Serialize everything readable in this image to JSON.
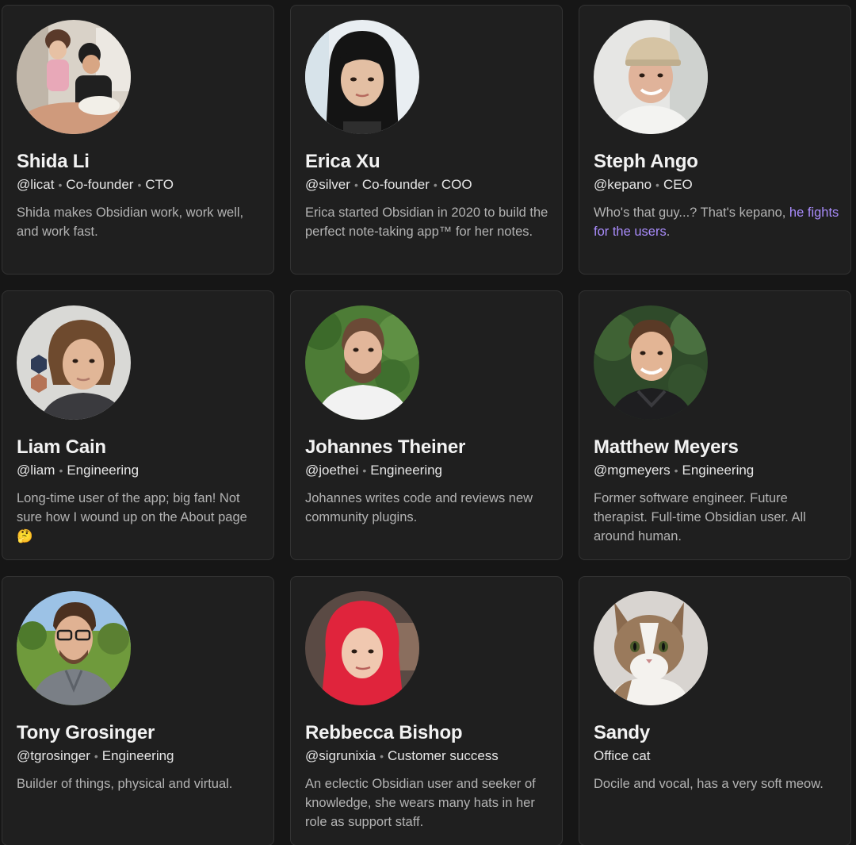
{
  "team": [
    {
      "name": "Shida Li",
      "handle": "@licat",
      "roles": [
        "Co-founder",
        "CTO"
      ],
      "bio": "Shida makes Obsidian work, work well, and work fast.",
      "avatar": "avatar-family-photo"
    },
    {
      "name": "Erica Xu",
      "handle": "@silver",
      "roles": [
        "Co-founder",
        "COO"
      ],
      "bio": "Erica started Obsidian in 2020 to build the perfect note-taking app™ for her notes.",
      "avatar": "avatar-portrait"
    },
    {
      "name": "Steph Ango",
      "handle": "@kepano",
      "roles": [
        "CEO"
      ],
      "bio": "Who's that guy...? That's kepano, ",
      "bio_link": "he fights for the users",
      "bio_end": ".",
      "avatar": "avatar-portrait-cap"
    },
    {
      "name": "Liam Cain",
      "handle": "@liam",
      "roles": [
        "Engineering"
      ],
      "bio": "Long-time user of the app; big fan! Not sure how I wound up on the About page 🤔",
      "avatar": "avatar-portrait"
    },
    {
      "name": "Johannes Theiner",
      "handle": "@joethei",
      "roles": [
        "Engineering"
      ],
      "bio": "Johannes writes code and reviews new community plugins.",
      "avatar": "avatar-portrait-outdoor"
    },
    {
      "name": "Matthew Meyers",
      "handle": "@mgmeyers",
      "roles": [
        "Engineering"
      ],
      "bio": "Former software engineer. Future therapist. Full-time Obsidian user. All around human.",
      "avatar": "avatar-portrait-outdoor"
    },
    {
      "name": "Tony Grosinger",
      "handle": "@tgrosinger",
      "roles": [
        "Engineering"
      ],
      "bio": "Builder of things, physical and virtual.",
      "avatar": "avatar-portrait-outdoor"
    },
    {
      "name": "Rebbecca Bishop",
      "handle": "@sigrunixia",
      "roles": [
        "Customer success"
      ],
      "bio": "An eclectic Obsidian user and seeker of knowledge, she wears many hats in her role as support staff.",
      "avatar": "avatar-portrait-red-hair"
    },
    {
      "name": "Sandy",
      "handle": "",
      "roles": [
        "Office cat"
      ],
      "bio": "Docile and vocal, has a very soft meow.",
      "avatar": "avatar-cat"
    }
  ],
  "colors": {
    "background": "#161616",
    "card": "#1f1f1f",
    "link": "#a88bfa"
  }
}
